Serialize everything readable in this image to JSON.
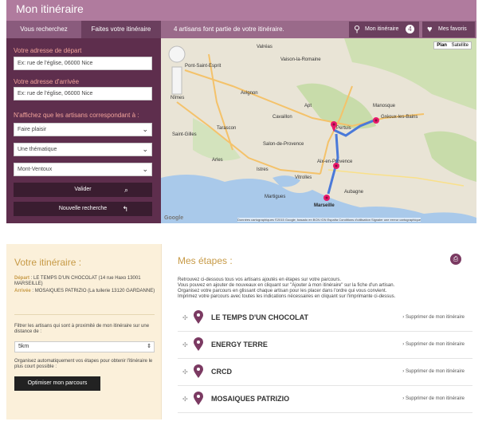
{
  "header": {
    "title": "Mon itinéraire",
    "tab_search": "Vous recherchez",
    "tab_itinerary": "Faites votre itinéraire",
    "artisans_count_text": "4 artisans font partie de votre itinéraire.",
    "my_itinerary_label": "Mon itinéraire",
    "my_itinerary_count": "4",
    "favorites_label": "Mes favoris"
  },
  "form": {
    "start_label": "Votre adresse de départ",
    "start_value": "Ex: rue de l'église, 06000 Nice",
    "end_label": "Votre adresse d'arrivée",
    "end_value": "Ex: rue de l'église, 06000 Nice",
    "filter_label": "N'affichez que les artisans correspondant à :",
    "select1": "Faire plaisir",
    "select2": "Une thématique",
    "select3": "Mont-Ventoux",
    "validate_label": "Valider",
    "new_search_label": "Nouvelle recherche"
  },
  "map": {
    "mode_plan": "Plan",
    "mode_sat": "Satellite",
    "labels": [
      "Nîmes",
      "Arles",
      "Avignon",
      "Apt",
      "Cavaillon",
      "Pertuis",
      "Aix-en-Provence",
      "Marseille",
      "Manosque",
      "Gréoux-les-Bains",
      "Istres",
      "Martigues",
      "Aubagne",
      "Salon-de-Provence",
      "Vitrolles",
      "Saint-Gilles",
      "Tarascon",
      "Pont-Saint-Esprit",
      "Valréas",
      "Vaison-la-Romaine"
    ],
    "attribution": "Données cartographiques ©2015 Google, basado en BCN IGN España   Conditions d'utilisation   Signaler une erreur cartographique",
    "brand": "Google"
  },
  "summary": {
    "title": "Votre itinéraire :",
    "depart_label": "Départ",
    "depart_value": "LE TEMPS D'UN CHOCOLAT (14 rue Haxo 13001 MARSEILLE)",
    "arrivee_label": "Arrivée",
    "arrivee_value": "MOSAIQUES PATRIZIO (La tuilerie 13120 GARDANNE)",
    "filter_text": "Filtrer les artisans qui sont à proximité de mon itinéraire sur une distance de :",
    "distance": "5km",
    "optimize_text": "Organisez automatiquement vos étapes pour obtenir l'itinéraire le plus court possible :",
    "optimize_button": "Optimiser mon parcours"
  },
  "steps": {
    "title": "Mes étapes :",
    "intro_lines": [
      "Retrouvez ci-dessous tous vos artisans ajoutés en étapes sur votre parcours.",
      "Vous pouvez en ajouter de nouveaux en cliquant sur \"Ajouter à mon itinéraire\" sur la fiche d'un artisan.",
      "Organisez votre parcours en glissant chaque artisan pour les placer dans l'ordre qui vous convient.",
      "Imprimez votre parcours avec toutes les indications nécessaires en cliquant sur l'imprimante ci-dessus."
    ],
    "remove_label": "Supprimer de mon itinéraire",
    "items": [
      {
        "name": "LE TEMPS D'UN CHOCOLAT"
      },
      {
        "name": "ENERGY TERRE"
      },
      {
        "name": "CRCD"
      },
      {
        "name": "MOSAIQUES PATRIZIO"
      }
    ]
  },
  "colors": {
    "brand_dark": "#5e2e4d",
    "brand_mid": "#9a6a8a",
    "accent_gold": "#c79a46",
    "pin": "#e8196b"
  }
}
